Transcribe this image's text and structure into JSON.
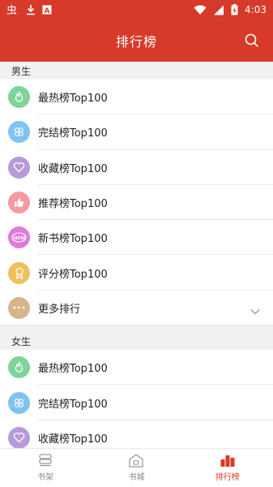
{
  "status_bar": {
    "time": "4:03",
    "left_icons": [
      "app-notification-icon",
      "download-icon",
      "text-a-icon"
    ],
    "right_icons": [
      "wifi-icon",
      "signal-icon",
      "battery-icon"
    ]
  },
  "header": {
    "title": "排行榜",
    "search_icon": "search-icon"
  },
  "colors": {
    "primary": "#d63a2a",
    "green": "#7ed49a",
    "blue": "#7fc3f0",
    "purple": "#b79ad9",
    "pink": "#f49aa0",
    "magenta": "#df7bd8",
    "yellow": "#f0c05a",
    "tan": "#d9b48a"
  },
  "sections": [
    {
      "title": "男生",
      "items": [
        {
          "label": "最热榜Top100",
          "icon": "flame-icon",
          "color": "#7ed49a"
        },
        {
          "label": "完结榜Top100",
          "icon": "clover-icon",
          "color": "#7fc3f0"
        },
        {
          "label": "收藏榜Top100",
          "icon": "heart-icon",
          "color": "#b79ad9"
        },
        {
          "label": "推荐榜Top100",
          "icon": "thumbs-up-icon",
          "color": "#f49aa0"
        },
        {
          "label": "新书榜Top100",
          "icon": "new-badge-icon",
          "color": "#df7bd8"
        },
        {
          "label": "评分榜Top100",
          "icon": "award-icon",
          "color": "#f0c05a"
        },
        {
          "label": "更多排行",
          "icon": "more-icon",
          "color": "#d9b48a",
          "expandable": true
        }
      ]
    },
    {
      "title": "女生",
      "items": [
        {
          "label": "最热榜Top100",
          "icon": "flame-icon",
          "color": "#7ed49a"
        },
        {
          "label": "完结榜Top100",
          "icon": "clover-icon",
          "color": "#7fc3f0"
        },
        {
          "label": "收藏榜Top100",
          "icon": "heart-icon",
          "color": "#b79ad9"
        }
      ]
    }
  ],
  "tabs": [
    {
      "label": "书架",
      "icon": "bookshelf-icon",
      "active": false
    },
    {
      "label": "书城",
      "icon": "bookstore-icon",
      "active": false
    },
    {
      "label": "排行榜",
      "icon": "ranking-icon",
      "active": true
    }
  ]
}
